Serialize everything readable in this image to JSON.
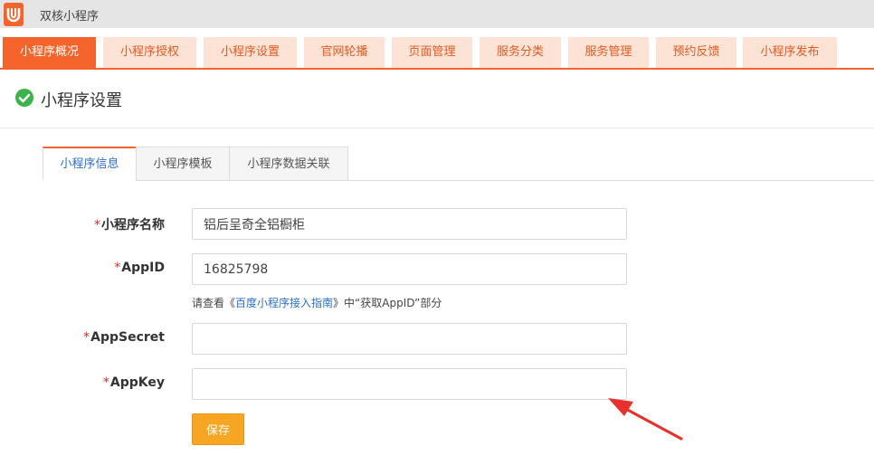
{
  "app": {
    "title": "双核小程序",
    "logo_icon": "u-logo-icon"
  },
  "nav": {
    "items": [
      {
        "label": "小程序概况",
        "active": true
      },
      {
        "label": "小程序授权",
        "active": false
      },
      {
        "label": "小程序设置",
        "active": false
      },
      {
        "label": "官网轮播",
        "active": false
      },
      {
        "label": "页面管理",
        "active": false
      },
      {
        "label": "服务分类",
        "active": false
      },
      {
        "label": "服务管理",
        "active": false
      },
      {
        "label": "预约反馈",
        "active": false
      },
      {
        "label": "小程序发布",
        "active": false
      }
    ]
  },
  "section": {
    "title": "小程序设置",
    "icon": "check-circle-icon"
  },
  "tabs": [
    {
      "label": "小程序信息",
      "active": true
    },
    {
      "label": "小程序模板",
      "active": false
    },
    {
      "label": "小程序数据关联",
      "active": false
    }
  ],
  "form": {
    "required_mark": "*",
    "name": {
      "label": "小程序名称",
      "value": "铝后呈奇全铝橱柜"
    },
    "appid": {
      "label": "AppID",
      "value": "16825798"
    },
    "hint": {
      "before": "请查看《",
      "link": "百度小程序接入指南",
      "after": "》中“获取AppID”部分"
    },
    "appsecret": {
      "label": "AppSecret",
      "value": ""
    },
    "appkey": {
      "label": "AppKey",
      "value": ""
    },
    "save_label": "保存"
  },
  "colors": {
    "brand": "#f5642b",
    "nav_bg": "#fde3d5",
    "save": "#f6a623",
    "link": "#2b70c9",
    "check": "#3cb34a",
    "arrow": "#e8312b"
  }
}
